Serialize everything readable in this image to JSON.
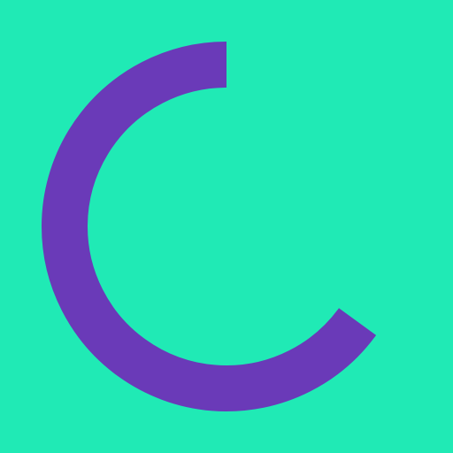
{
  "logo": {
    "icon": "open-ring-arc-icon",
    "background_color": "#20EAB5",
    "arc_color": "#6A3AB8",
    "arc_fraction": 0.65
  }
}
